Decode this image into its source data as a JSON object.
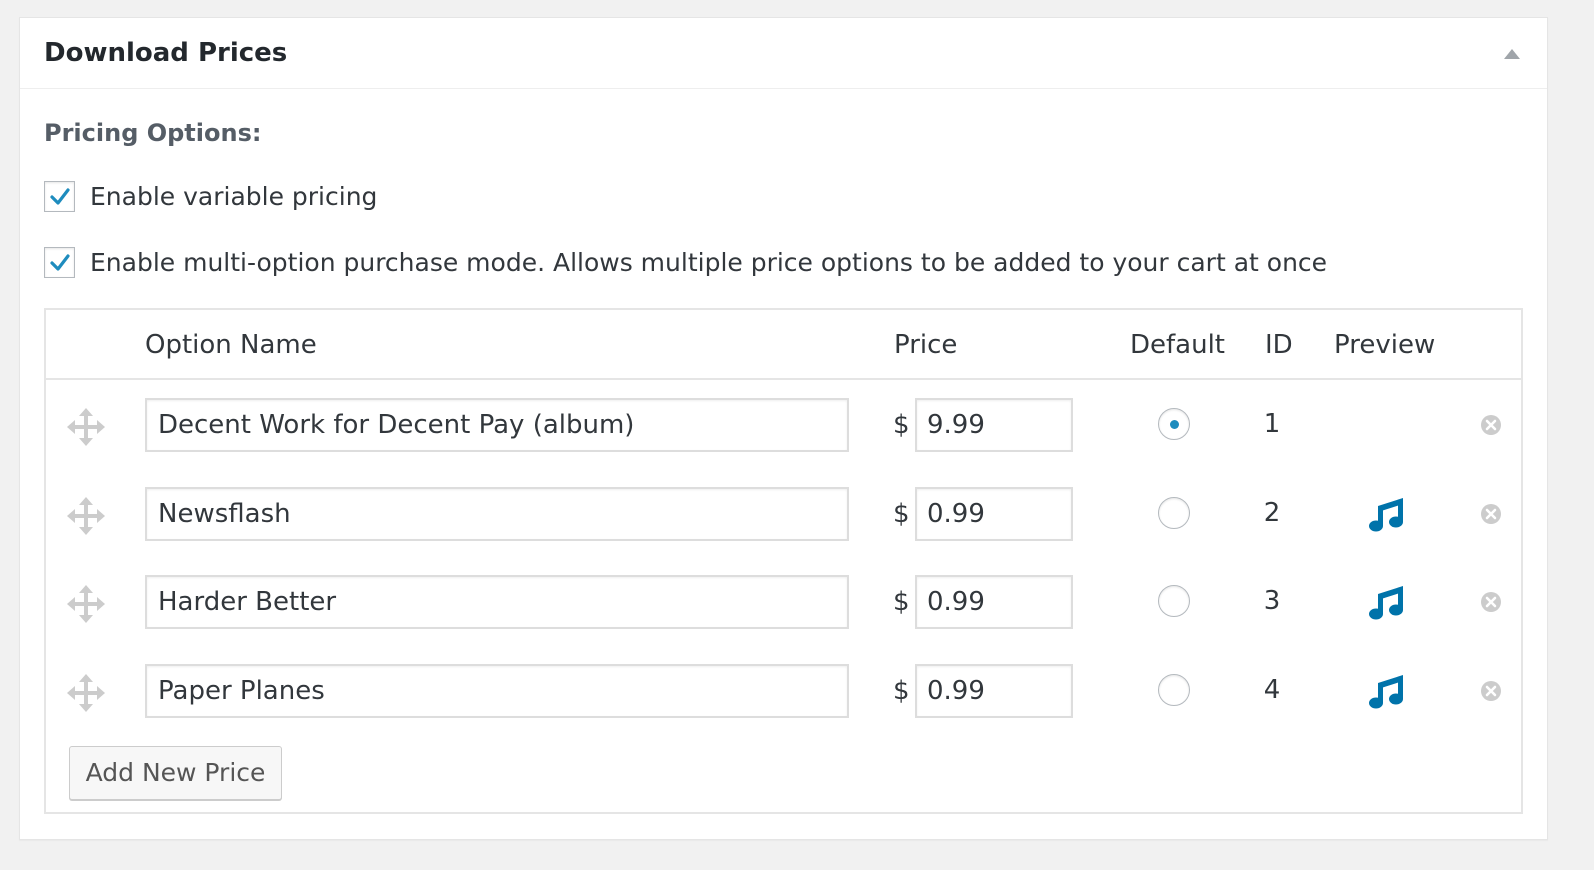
{
  "metabox": {
    "title": "Download Prices",
    "toggle_icon": "triangle-up-icon"
  },
  "pricing": {
    "section_label": "Pricing Options:",
    "variable_pricing": {
      "label": "Enable variable pricing",
      "checked": true
    },
    "multi_option": {
      "label": "Enable multi-option purchase mode. Allows multiple price options to be added to your cart at once",
      "checked": true
    }
  },
  "table": {
    "headers": {
      "option_name": "Option Name",
      "price": "Price",
      "default": "Default",
      "id": "ID",
      "preview": "Preview"
    },
    "currency_symbol": "$",
    "rows": [
      {
        "name": "Decent Work for Decent Pay (album)",
        "price": "9.99",
        "default": true,
        "id": "1",
        "has_preview": false
      },
      {
        "name": "Newsflash",
        "price": "0.99",
        "default": false,
        "id": "2",
        "has_preview": true
      },
      {
        "name": "Harder Better",
        "price": "0.99",
        "default": false,
        "id": "3",
        "has_preview": true
      },
      {
        "name": "Paper Planes",
        "price": "0.99",
        "default": false,
        "id": "4",
        "has_preview": true
      }
    ]
  },
  "add_button_label": "Add New Price",
  "colors": {
    "accent": "#1e8cbe",
    "preview_icon": "#0073aa",
    "muted_icon": "#cccccc"
  },
  "icons": {
    "drag": "move-arrows-icon",
    "preview": "music-note-icon",
    "remove": "remove-circle-x-icon",
    "checkbox": "checkmark-icon"
  }
}
